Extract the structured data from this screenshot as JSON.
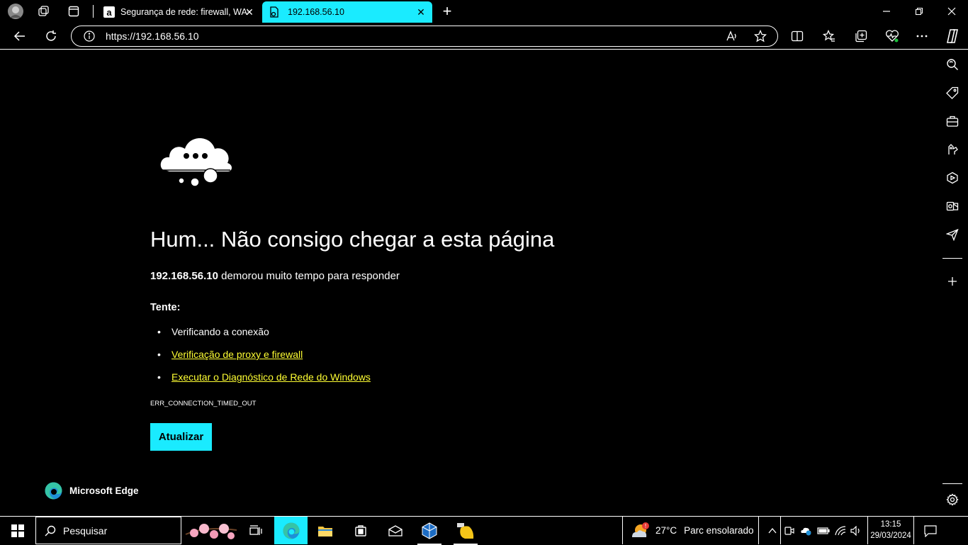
{
  "tabstrip": {
    "tabs": [
      {
        "title": "Segurança de rede: firewall, WAF",
        "icon": "atom-a-icon",
        "active": false
      },
      {
        "title": "192.168.56.10",
        "icon": "page-error-icon",
        "active": true
      }
    ],
    "close_glyph": "✕",
    "new_tab_glyph": "+"
  },
  "toolbar": {
    "url": "https://192.168.56.10"
  },
  "error_page": {
    "heading": "Hum... Não consigo chegar a esta página",
    "host": "192.168.56.10",
    "message": " demorou muito tempo para responder",
    "try_label": "Tente:",
    "suggestions": [
      {
        "text": "Verificando a conexão",
        "link": false
      },
      {
        "text": "Verificação de proxy e firewall",
        "link": true
      },
      {
        "text": "Executar o Diagnóstico de Rede do Windows",
        "link": true
      }
    ],
    "bullet": "•",
    "error_code": "ERR_CONNECTION_TIMED_OUT",
    "refresh_label": "Atualizar",
    "brand": "Microsoft Edge"
  },
  "taskbar": {
    "search_placeholder": "Pesquisar",
    "weather": {
      "temp": "27°C",
      "condition": "Parc ensolarado"
    },
    "clock": {
      "time": "13:15",
      "date": "29/03/2024"
    }
  },
  "colors": {
    "accent": "#1aebff",
    "link": "#ffff33",
    "background": "#000000",
    "text": "#ffffff"
  }
}
